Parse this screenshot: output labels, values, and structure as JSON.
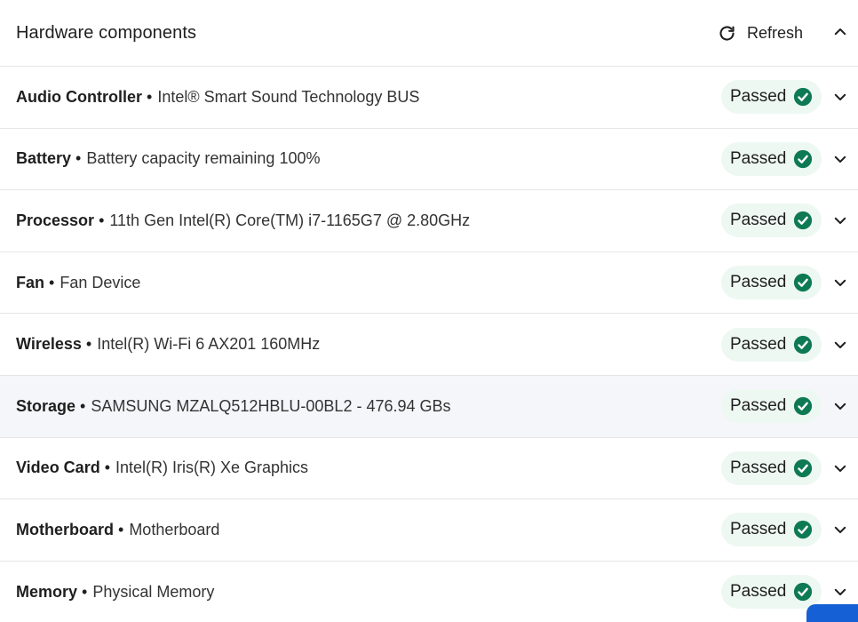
{
  "header": {
    "title": "Hardware components",
    "refresh_label": "Refresh"
  },
  "status_color": "#0e7a55",
  "rows": [
    {
      "name": "Audio Controller",
      "separator": "•",
      "description": "Intel® Smart Sound Technology BUS",
      "status": "Passed"
    },
    {
      "name": "Battery",
      "separator": "•",
      "description": "Battery capacity remaining 100%",
      "status": "Passed"
    },
    {
      "name": "Processor",
      "separator": "•",
      "description": "11th Gen Intel(R) Core(TM) i7-1165G7 @ 2.80GHz",
      "status": "Passed"
    },
    {
      "name": "Fan",
      "separator": "•",
      "description": "Fan Device",
      "status": "Passed"
    },
    {
      "name": "Wireless",
      "separator": "•",
      "description": "Intel(R) Wi-Fi 6 AX201 160MHz",
      "status": "Passed"
    },
    {
      "name": "Storage",
      "separator": "•",
      "description": "SAMSUNG MZALQ512HBLU-00BL2 - 476.94 GBs",
      "status": "Passed"
    },
    {
      "name": "Video Card",
      "separator": "•",
      "description": "Intel(R) Iris(R) Xe Graphics",
      "status": "Passed"
    },
    {
      "name": "Motherboard",
      "separator": "•",
      "description": "Motherboard",
      "status": "Passed"
    },
    {
      "name": "Memory",
      "separator": "•",
      "description": "Physical Memory",
      "status": "Passed"
    }
  ],
  "icons": {
    "refresh": "refresh-icon",
    "collapse": "chevron-up-icon",
    "expand": "chevron-down-icon",
    "status": "check-circle-icon"
  }
}
